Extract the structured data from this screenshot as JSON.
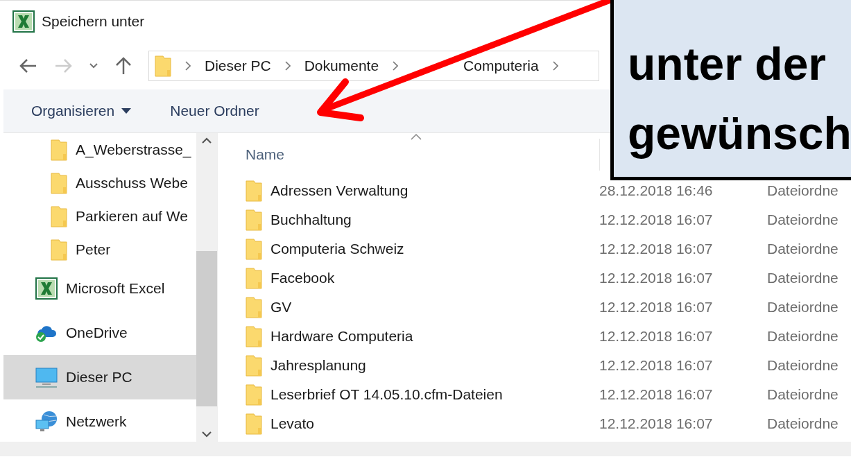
{
  "window": {
    "title": "Speichern unter"
  },
  "navigation": {
    "breadcrumb": [
      "Dieser PC",
      "Dokumente",
      "Computeria"
    ]
  },
  "toolbar": {
    "organize": "Organisieren",
    "new_folder": "Neuer Ordner"
  },
  "sidebar": {
    "items": [
      {
        "kind": "folder",
        "label": "A_Weberstrasse_",
        "selected": false
      },
      {
        "kind": "folder",
        "label": "Ausschuss Webe",
        "selected": false
      },
      {
        "kind": "folder",
        "label": "Parkieren auf We",
        "selected": false
      },
      {
        "kind": "folder",
        "label": "Peter",
        "selected": false
      },
      {
        "kind": "excel",
        "label": "Microsoft Excel",
        "selected": false
      },
      {
        "kind": "onedrive",
        "label": "OneDrive",
        "selected": false
      },
      {
        "kind": "pc",
        "label": "Dieser PC",
        "selected": true
      },
      {
        "kind": "network",
        "label": "Netzwerk",
        "selected": false
      }
    ]
  },
  "table": {
    "columns": [
      "Name"
    ],
    "rows": [
      {
        "name": "Adressen Verwaltung",
        "date": "28.12.2018 16:46",
        "type": "Dateiordne"
      },
      {
        "name": "Buchhaltung",
        "date": "12.12.2018 16:07",
        "type": "Dateiordne"
      },
      {
        "name": "Computeria Schweiz",
        "date": "12.12.2018 16:07",
        "type": "Dateiordne"
      },
      {
        "name": "Facebook",
        "date": "12.12.2018 16:07",
        "type": "Dateiordne"
      },
      {
        "name": "GV",
        "date": "12.12.2018 16:07",
        "type": "Dateiordne"
      },
      {
        "name": "Hardware Computeria",
        "date": "12.12.2018 16:07",
        "type": "Dateiordne"
      },
      {
        "name": "Jahresplanung",
        "date": "12.12.2018 16:07",
        "type": "Dateiordne"
      },
      {
        "name": "Leserbrief OT 14.05.10.cfm-Dateien",
        "date": "12.12.2018 16:07",
        "type": "Dateiordne"
      },
      {
        "name": "Levato",
        "date": "12.12.2018 16:07",
        "type": "Dateiordne"
      }
    ]
  },
  "callout": {
    "lines": [
      "unter der",
      "gewünsch"
    ]
  }
}
